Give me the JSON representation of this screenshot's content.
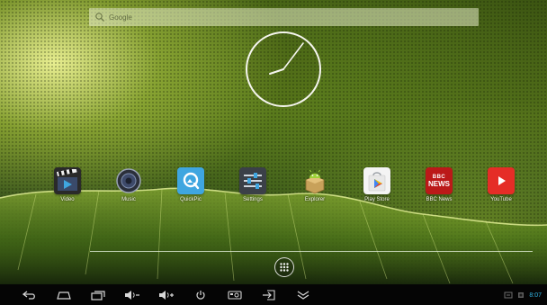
{
  "search": {
    "placeholder": "Google"
  },
  "apps": [
    {
      "id": "video",
      "label": "Video",
      "icon": "clapperboard-icon"
    },
    {
      "id": "music",
      "label": "Music",
      "icon": "speaker-icon"
    },
    {
      "id": "quickpic",
      "label": "QuickPic",
      "icon": "quickpic-icon"
    },
    {
      "id": "settings",
      "label": "Settings",
      "icon": "settings-sliders-icon"
    },
    {
      "id": "explorer",
      "label": "Explorer",
      "icon": "android-package-icon"
    },
    {
      "id": "playstore",
      "label": "Play Store",
      "icon": "play-store-bag-icon"
    },
    {
      "id": "bbcnews",
      "label": "BBC News",
      "icon": "bbc-news-icon",
      "text_top": "BBC",
      "text_bottom": "NEWS"
    },
    {
      "id": "youtube",
      "label": "YouTube",
      "icon": "youtube-play-icon"
    }
  ],
  "nav": [
    {
      "id": "back",
      "icon": "back-arrow-icon"
    },
    {
      "id": "home",
      "icon": "home-icon"
    },
    {
      "id": "recent",
      "icon": "recent-apps-icon"
    },
    {
      "id": "vol-down",
      "icon": "volume-down-icon"
    },
    {
      "id": "vol-up",
      "icon": "volume-up-icon"
    },
    {
      "id": "power",
      "icon": "power-icon"
    },
    {
      "id": "screenshot",
      "icon": "screenshot-icon"
    },
    {
      "id": "input",
      "icon": "input-source-icon"
    },
    {
      "id": "hide",
      "icon": "chevron-down-icon"
    }
  ],
  "status": {
    "time": "8:07"
  },
  "colors": {
    "accent": "#33b5e5",
    "youtube_red": "#e52d27",
    "bbc_red": "#bb1919",
    "quickpic_blue": "#3fa6e0"
  }
}
